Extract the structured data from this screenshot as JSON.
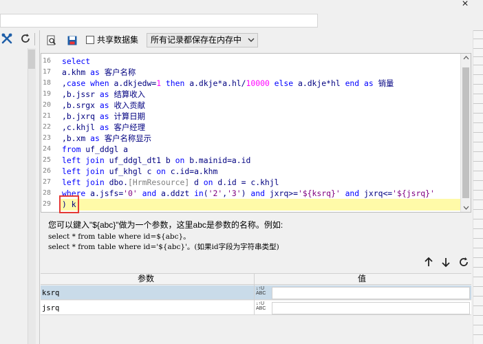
{
  "window": {
    "close_glyph": "×"
  },
  "left_toolbar": {
    "icons": [
      "tools-icon",
      "refresh-icon"
    ]
  },
  "toolbar": {
    "icons": [
      "preview-icon",
      "save-icon"
    ],
    "share_label": "共享数据集",
    "memory_select": "所有记录都保存在内存中"
  },
  "editor": {
    "line_numbers": [
      "16",
      "17",
      "18",
      "19",
      "20",
      "21",
      "22",
      "23",
      "24",
      "25",
      "26",
      "27",
      "28",
      "29"
    ],
    "lines": [
      "select",
      "a.khm as 客户名称",
      ",case when a.dkjedw=1 then a.dkje*a.hl/10000 else a.dkje*hl end as 销量",
      ",b.jssr as 结算收入",
      ",b.srgx as 收入贡献",
      ",b.jxrq as 计算日期",
      ",c.khjl as 客户经理",
      ",b.xm as 客户名称显示",
      "from uf_ddgl a",
      "left join uf_ddgl_dt1 b on b.mainid=a.id",
      "left join uf_khgl c on c.id=a.khm",
      "left join dbo.[HrmResource] d on d.id = c.khjl",
      "where a.jsfs='0' and a.ddzt in('2','3') and jxrq>='${ksrq}' and jxrq<='${jsrq}'",
      ") k"
    ]
  },
  "hints": {
    "line1": "您可以鍵入\"${abc}\"做为一个参数，这里abc是参数的名称。例如:",
    "line2": "select * from table where id=${abc}。",
    "line3": "select * from table where id='${abc}'。(如果id字段为字符串类型)"
  },
  "params": {
    "header_name": "参数",
    "header_value": "值",
    "rows": [
      {
        "name": "ksrq",
        "value": ""
      },
      {
        "name": "jsrq",
        "value": ""
      }
    ],
    "type_icon_text": "ABC"
  },
  "colors": {
    "keyword": "#0000ff",
    "string": "#800080",
    "number": "#ff00ff",
    "current_line": "#fffaa8",
    "selected_row": "#c9dbe9",
    "highlight_box": "#e53935"
  }
}
